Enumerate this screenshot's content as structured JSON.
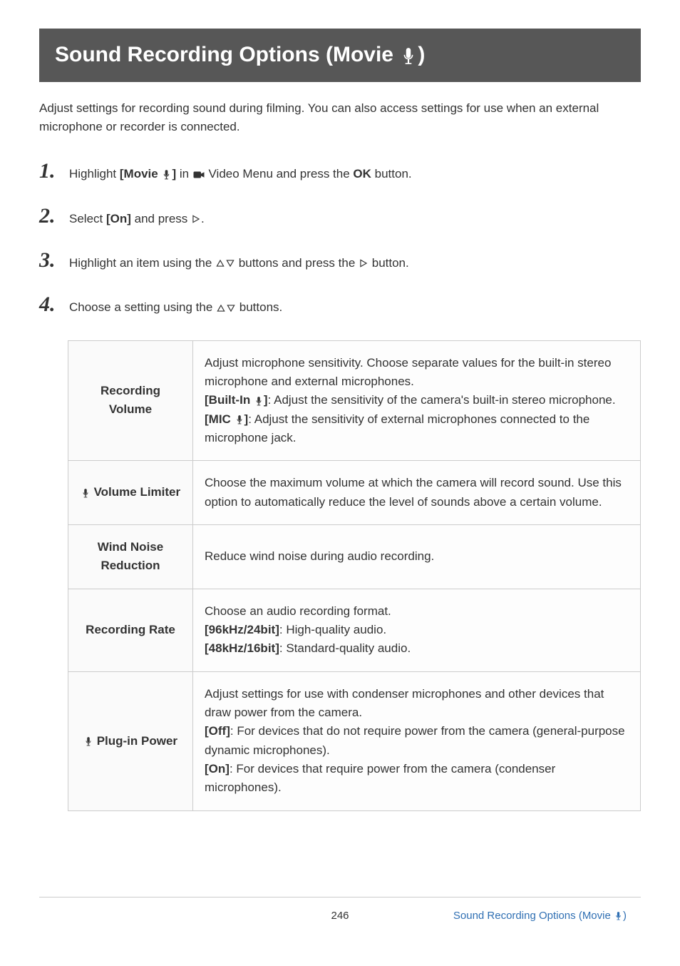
{
  "title_prefix": "Sound Recording Options (Movie ",
  "title_suffix": ")",
  "intro": "Adjust settings for recording sound during filming. You can also access settings for use when an external microphone or recorder is connected.",
  "steps": {
    "s1_a": "Highlight ",
    "s1_b": "[Movie ",
    "s1_c": "]",
    "s1_d": " in ",
    "s1_e": " Video Menu and press the ",
    "s1_f": "OK",
    "s1_g": " button.",
    "s2_a": "Select ",
    "s2_b": "[On]",
    "s2_c": " and press ",
    "s2_d": ".",
    "s3_a": "Highlight an item using the ",
    "s3_b": " buttons and press the ",
    "s3_c": " button.",
    "s4_a": "Choose a setting using the ",
    "s4_b": " buttons."
  },
  "table": {
    "row1_label": "Recording Volume",
    "row1_a": "Adjust microphone sensitivity. Choose separate values for the built-in stereo microphone and external microphones.",
    "row1_b1": "[Built-In ",
    "row1_b2": "]",
    "row1_b3": ": Adjust the sensitivity of the camera's built-in stereo microphone.",
    "row1_c1": "[MIC ",
    "row1_c2": "]",
    "row1_c3": ": Adjust the sensitivity of external microphones connected to the microphone jack.",
    "row2_label": " Volume Limiter",
    "row2_desc": "Choose the maximum volume at which the camera will record sound. Use this option to automatically reduce the level of sounds above a certain volume.",
    "row3_label": "Wind Noise Reduction",
    "row3_desc": "Reduce wind noise during audio recording.",
    "row4_label": "Recording Rate",
    "row4_a": "Choose an audio recording format.",
    "row4_b1": "[96kHz/24bit]",
    "row4_b2": ": High-quality audio.",
    "row4_c1": "[48kHz/16bit]",
    "row4_c2": ": Standard-quality audio.",
    "row5_label": " Plug-in Power",
    "row5_a": "Adjust settings for use with condenser microphones and other devices that draw power from the camera.",
    "row5_b1": "[Off]",
    "row5_b2": ": For devices that do not require power from the camera (general-purpose dynamic microphones).",
    "row5_c1": "[On]",
    "row5_c2": ": For devices that require power from the camera (condenser microphones)."
  },
  "footer": {
    "page": "246",
    "link_a": "Sound Recording Options (Movie ",
    "link_b": ")"
  }
}
